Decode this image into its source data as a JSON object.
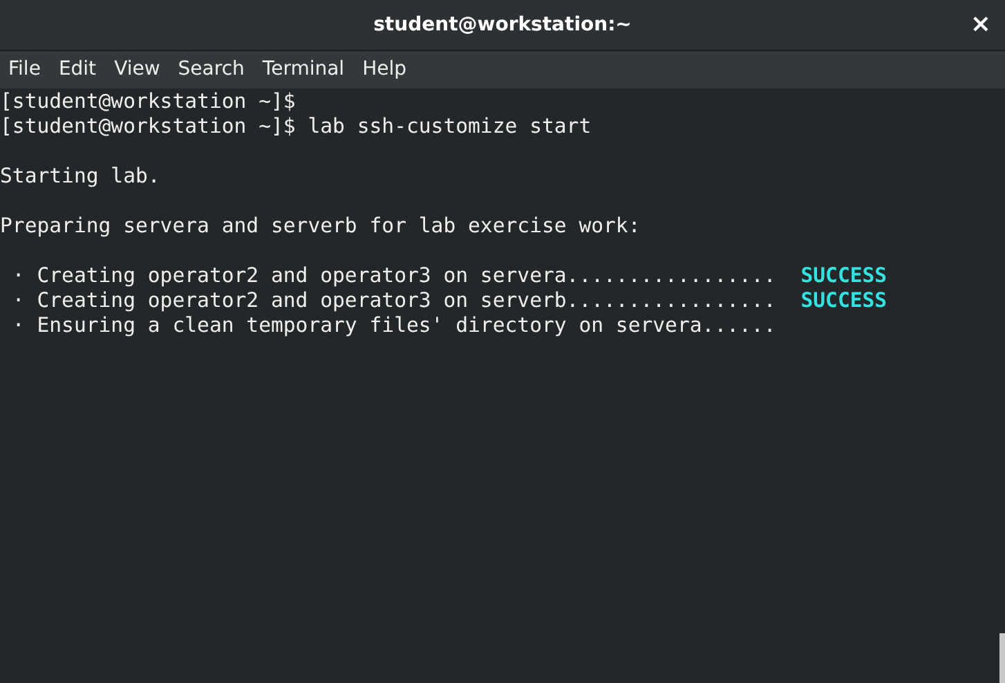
{
  "window": {
    "title": "student@workstation:~",
    "close": "×"
  },
  "menu": [
    "File",
    "Edit",
    "View",
    "Search",
    "Terminal",
    "Help"
  ],
  "terminal": {
    "lines": [
      {
        "kind": "text",
        "text": "[student@workstation ~]$"
      },
      {
        "kind": "text",
        "text": "[student@workstation ~]$ lab ssh-customize start"
      },
      {
        "kind": "blank"
      },
      {
        "kind": "text",
        "text": "Starting lab."
      },
      {
        "kind": "blank"
      },
      {
        "kind": "text",
        "text": "Preparing servera and serverb for lab exercise work:"
      },
      {
        "kind": "blank"
      },
      {
        "kind": "text",
        "text": " · Creating operator2 and operator3 on servera.................",
        "status": "SUCCESS"
      },
      {
        "kind": "text",
        "text": " · Creating operator2 and operator3 on serverb.................",
        "status": "SUCCESS"
      },
      {
        "kind": "text",
        "text": " · Ensuring a clean temporary files' directory on servera......"
      }
    ]
  }
}
